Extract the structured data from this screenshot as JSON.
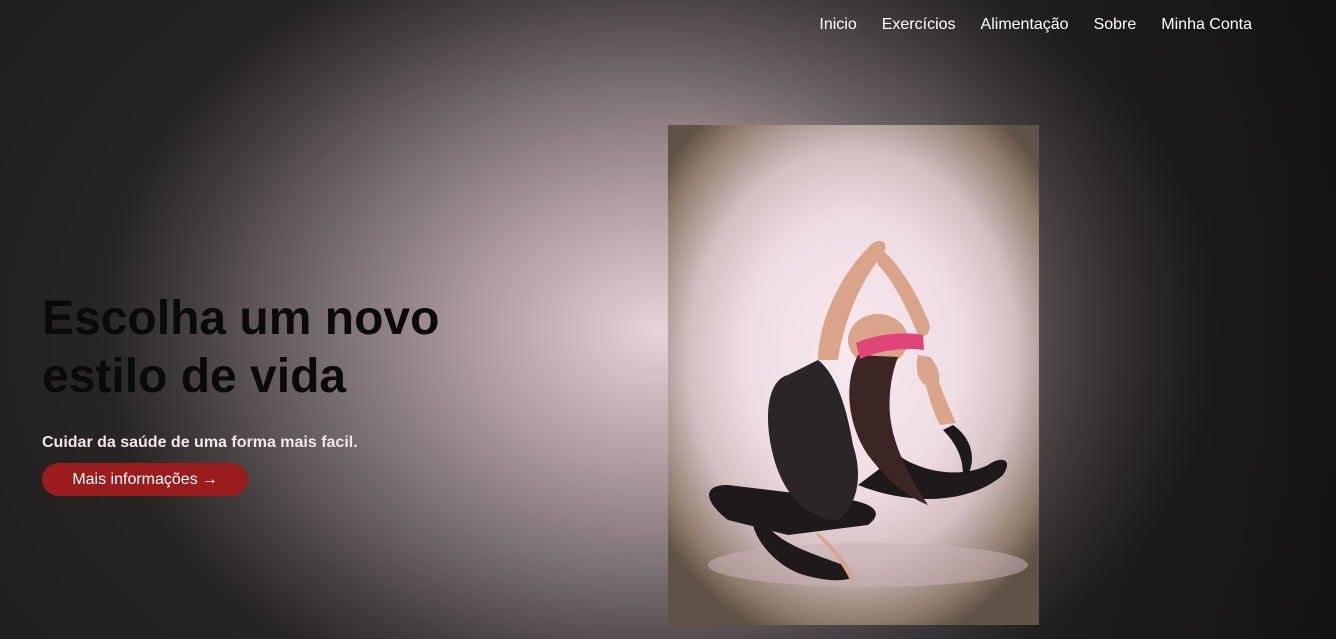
{
  "nav": {
    "items": [
      "Inicio",
      "Exercícios",
      "Alimentação",
      "Sobre",
      "Minha Conta"
    ]
  },
  "hero": {
    "title": "Escolha um novo estilo de vida",
    "subtitle": "Cuidar da saúde de uma forma mais facil.",
    "cta_label": "Mais informações",
    "cta_icon": "→"
  },
  "colors": {
    "cta_background": "#9b1c1c",
    "headband": "#e0457a",
    "nav_text": "#ffffff"
  },
  "icons": {
    "cta_arrow": "arrow-right-icon"
  }
}
